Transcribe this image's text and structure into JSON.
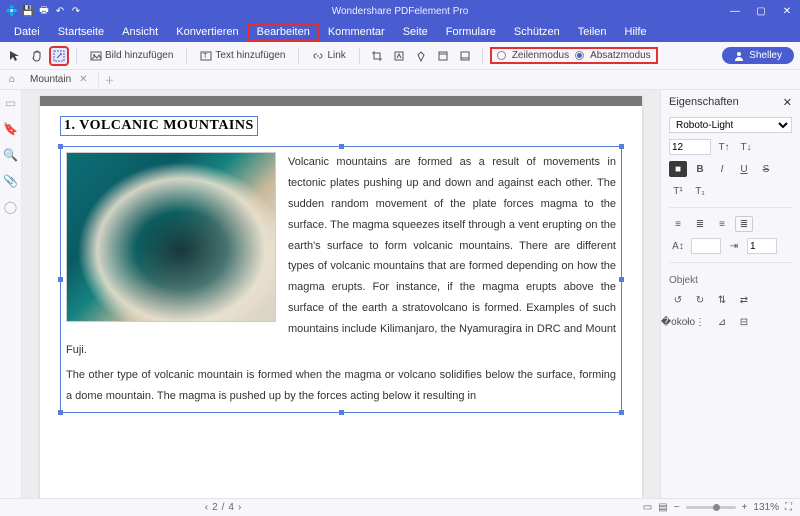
{
  "app": {
    "title": "Wondershare PDFelement Pro"
  },
  "menu": {
    "items": [
      "Datei",
      "Startseite",
      "Ansicht",
      "Konvertieren",
      "Bearbeiten",
      "Kommentar",
      "Seite",
      "Formulare",
      "Schützen",
      "Teilen",
      "Hilfe"
    ],
    "highlighted": "Bearbeiten"
  },
  "toolbar": {
    "add_image": "Bild hinzufügen",
    "add_text": "Text hinzufügen",
    "link": "Link",
    "mode_line": "Zeilenmodus",
    "mode_para": "Absatzmodus",
    "user": "Shelley"
  },
  "tabs": {
    "active": "Mountain"
  },
  "document": {
    "heading": "1. VOLCANIC MOUNTAINS",
    "para1": "Volcanic mountains are formed as a result of movements in tectonic plates pushing up and down and against each other. The sudden random movement of the plate forces magma to the surface. The magma squeezes itself through a vent erupting on the earth's surface to form volcanic mountains. There are different types of volcanic mountains that are formed depending on how the magma erupts. For instance, if the magma erupts above the surface of the earth a stratovolcano is formed. Examples of such mountains include Kilimanjaro, the Nyamuragira in DRC and Mount Fuji. ",
    "para2": "The other type of volcanic mountain is formed when the magma or volcano solidifies below the surface, forming a dome mountain. The magma is pushed up by the forces acting below it resulting in"
  },
  "properties": {
    "title": "Eigenschaften",
    "font": "Roboto-Light",
    "size": "12",
    "object_title": "Objekt",
    "indent_val": "1"
  },
  "status": {
    "page_current": "2",
    "page_total": "4",
    "zoom": "131%"
  }
}
